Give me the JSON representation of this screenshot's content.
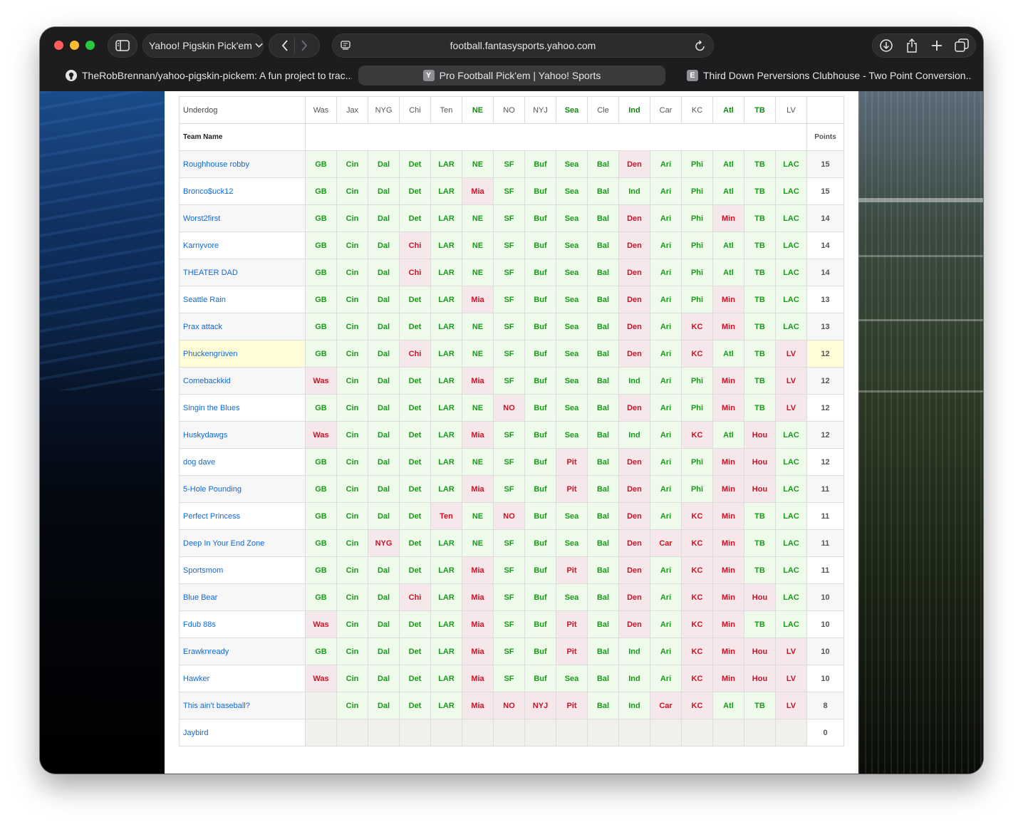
{
  "browser": {
    "tab_group": "Yahoo! Pigskin Pick'em",
    "url": "football.fantasysports.yahoo.com",
    "tabs": [
      {
        "favicon": "github-icon",
        "title": "TheRobBrennan/yahoo-pigskin-pickem: A fun project to trac..."
      },
      {
        "favicon": "Y",
        "title": "Pro Football Pick'em | Yahoo! Sports"
      },
      {
        "favicon": "E",
        "title": "Third Down Perversions Clubhouse - Two Point Conversion..."
      }
    ]
  },
  "table": {
    "underdog_label": "Underdog",
    "team_name_label": "Team Name",
    "points_label": "Points",
    "underdogs": [
      {
        "team": "Was",
        "covered": false
      },
      {
        "team": "Jax",
        "covered": false
      },
      {
        "team": "NYG",
        "covered": false
      },
      {
        "team": "Chi",
        "covered": false
      },
      {
        "team": "Ten",
        "covered": false
      },
      {
        "team": "NE",
        "covered": true
      },
      {
        "team": "NO",
        "covered": false
      },
      {
        "team": "NYJ",
        "covered": false
      },
      {
        "team": "Sea",
        "covered": true
      },
      {
        "team": "Cle",
        "covered": false
      },
      {
        "team": "Ind",
        "covered": true
      },
      {
        "team": "Car",
        "covered": false
      },
      {
        "team": "KC",
        "covered": false
      },
      {
        "team": "Atl",
        "covered": true
      },
      {
        "team": "TB",
        "covered": true
      },
      {
        "team": "LV",
        "covered": false
      }
    ],
    "rows": [
      {
        "name": "Roughhouse robby",
        "points": "15",
        "picks": [
          "GB:w",
          "Cin:w",
          "Dal:w",
          "Det:w",
          "LAR:w",
          "NE:w",
          "SF:w",
          "Buf:w",
          "Sea:w",
          "Bal:w",
          "Den:l",
          "Ari:w",
          "Phi:w",
          "Atl:w",
          "TB:w",
          "LAC:w"
        ]
      },
      {
        "name": "Bronco$uck12",
        "points": "15",
        "picks": [
          "GB:w",
          "Cin:w",
          "Dal:w",
          "Det:w",
          "LAR:w",
          "Mia:l",
          "SF:w",
          "Buf:w",
          "Sea:w",
          "Bal:w",
          "Ind:w",
          "Ari:w",
          "Phi:w",
          "Atl:w",
          "TB:w",
          "LAC:w"
        ]
      },
      {
        "name": "Worst2first",
        "points": "14",
        "picks": [
          "GB:w",
          "Cin:w",
          "Dal:w",
          "Det:w",
          "LAR:w",
          "NE:w",
          "SF:w",
          "Buf:w",
          "Sea:w",
          "Bal:w",
          "Den:l",
          "Ari:w",
          "Phi:w",
          "Min:l",
          "TB:w",
          "LAC:w"
        ]
      },
      {
        "name": "Karnyvore",
        "points": "14",
        "picks": [
          "GB:w",
          "Cin:w",
          "Dal:w",
          "Chi:l",
          "LAR:w",
          "NE:w",
          "SF:w",
          "Buf:w",
          "Sea:w",
          "Bal:w",
          "Den:l",
          "Ari:w",
          "Phi:w",
          "Atl:w",
          "TB:w",
          "LAC:w"
        ]
      },
      {
        "name": "THEATER DAD",
        "points": "14",
        "picks": [
          "GB:w",
          "Cin:w",
          "Dal:w",
          "Chi:l",
          "LAR:w",
          "NE:w",
          "SF:w",
          "Buf:w",
          "Sea:w",
          "Bal:w",
          "Den:l",
          "Ari:w",
          "Phi:w",
          "Atl:w",
          "TB:w",
          "LAC:w"
        ]
      },
      {
        "name": "Seattle Rain",
        "points": "13",
        "picks": [
          "GB:w",
          "Cin:w",
          "Dal:w",
          "Det:w",
          "LAR:w",
          "Mia:l",
          "SF:w",
          "Buf:w",
          "Sea:w",
          "Bal:w",
          "Den:l",
          "Ari:w",
          "Phi:w",
          "Min:l",
          "TB:w",
          "LAC:w"
        ]
      },
      {
        "name": "Prax attack",
        "points": "13",
        "picks": [
          "GB:w",
          "Cin:w",
          "Dal:w",
          "Det:w",
          "LAR:w",
          "NE:w",
          "SF:w",
          "Buf:w",
          "Sea:w",
          "Bal:w",
          "Den:l",
          "Ari:w",
          "KC:l",
          "Min:l",
          "TB:w",
          "LAC:w"
        ]
      },
      {
        "name": "Phuckengrüven",
        "points": "12",
        "me": true,
        "picks": [
          "GB:w",
          "Cin:w",
          "Dal:w",
          "Chi:l",
          "LAR:w",
          "NE:w",
          "SF:w",
          "Buf:w",
          "Sea:w",
          "Bal:w",
          "Den:l",
          "Ari:w",
          "KC:l",
          "Atl:w",
          "TB:w",
          "LV:l"
        ]
      },
      {
        "name": "Comebackkid",
        "points": "12",
        "picks": [
          "Was:l",
          "Cin:w",
          "Dal:w",
          "Det:w",
          "LAR:w",
          "Mia:l",
          "SF:w",
          "Buf:w",
          "Sea:w",
          "Bal:w",
          "Ind:w",
          "Ari:w",
          "Phi:w",
          "Min:l",
          "TB:w",
          "LV:l"
        ]
      },
      {
        "name": "Singin the Blues",
        "points": "12",
        "picks": [
          "GB:w",
          "Cin:w",
          "Dal:w",
          "Det:w",
          "LAR:w",
          "NE:w",
          "NO:l",
          "Buf:w",
          "Sea:w",
          "Bal:w",
          "Den:l",
          "Ari:w",
          "Phi:w",
          "Min:l",
          "TB:w",
          "LV:l"
        ]
      },
      {
        "name": "Huskydawgs",
        "points": "12",
        "picks": [
          "Was:l",
          "Cin:w",
          "Dal:w",
          "Det:w",
          "LAR:w",
          "Mia:l",
          "SF:w",
          "Buf:w",
          "Sea:w",
          "Bal:w",
          "Ind:w",
          "Ari:w",
          "KC:l",
          "Atl:w",
          "Hou:l",
          "LAC:w"
        ]
      },
      {
        "name": "dog dave",
        "points": "12",
        "picks": [
          "GB:w",
          "Cin:w",
          "Dal:w",
          "Det:w",
          "LAR:w",
          "NE:w",
          "SF:w",
          "Buf:w",
          "Pit:l",
          "Bal:w",
          "Den:l",
          "Ari:w",
          "Phi:w",
          "Min:l",
          "Hou:l",
          "LAC:w"
        ]
      },
      {
        "name": "5-Hole Pounding",
        "points": "11",
        "picks": [
          "GB:w",
          "Cin:w",
          "Dal:w",
          "Det:w",
          "LAR:w",
          "Mia:l",
          "SF:w",
          "Buf:w",
          "Pit:l",
          "Bal:w",
          "Den:l",
          "Ari:w",
          "Phi:w",
          "Min:l",
          "Hou:l",
          "LAC:w"
        ]
      },
      {
        "name": "Perfect Princess",
        "points": "11",
        "picks": [
          "GB:w",
          "Cin:w",
          "Dal:w",
          "Det:w",
          "Ten:l",
          "NE:w",
          "NO:l",
          "Buf:w",
          "Sea:w",
          "Bal:w",
          "Den:l",
          "Ari:w",
          "KC:l",
          "Min:l",
          "TB:w",
          "LAC:w"
        ]
      },
      {
        "name": "Deep In Your End Zone",
        "points": "11",
        "picks": [
          "GB:w",
          "Cin:w",
          "NYG:l",
          "Det:w",
          "LAR:w",
          "NE:w",
          "SF:w",
          "Buf:w",
          "Sea:w",
          "Bal:w",
          "Den:l",
          "Car:l",
          "KC:l",
          "Min:l",
          "TB:w",
          "LAC:w"
        ]
      },
      {
        "name": "Sportsmom",
        "points": "11",
        "picks": [
          "GB:w",
          "Cin:w",
          "Dal:w",
          "Det:w",
          "LAR:w",
          "Mia:l",
          "SF:w",
          "Buf:w",
          "Pit:l",
          "Bal:w",
          "Den:l",
          "Ari:w",
          "KC:l",
          "Min:l",
          "TB:w",
          "LAC:w"
        ]
      },
      {
        "name": "Blue Bear",
        "points": "10",
        "picks": [
          "GB:w",
          "Cin:w",
          "Dal:w",
          "Chi:l",
          "LAR:w",
          "Mia:l",
          "SF:w",
          "Buf:w",
          "Sea:w",
          "Bal:w",
          "Den:l",
          "Ari:w",
          "KC:l",
          "Min:l",
          "Hou:l",
          "LAC:w"
        ]
      },
      {
        "name": "Fdub 88s",
        "points": "10",
        "picks": [
          "Was:l",
          "Cin:w",
          "Dal:w",
          "Det:w",
          "LAR:w",
          "Mia:l",
          "SF:w",
          "Buf:w",
          "Pit:l",
          "Bal:w",
          "Den:l",
          "Ari:w",
          "KC:l",
          "Min:l",
          "TB:w",
          "LAC:w"
        ]
      },
      {
        "name": "Erawknready",
        "points": "10",
        "picks": [
          "GB:w",
          "Cin:w",
          "Dal:w",
          "Det:w",
          "LAR:w",
          "Mia:l",
          "SF:w",
          "Buf:w",
          "Pit:l",
          "Bal:w",
          "Ind:w",
          "Ari:w",
          "KC:l",
          "Min:l",
          "Hou:l",
          "LV:l"
        ]
      },
      {
        "name": "Hawker",
        "points": "10",
        "picks": [
          "Was:l",
          "Cin:w",
          "Dal:w",
          "Det:w",
          "LAR:w",
          "Mia:l",
          "SF:w",
          "Buf:w",
          "Sea:w",
          "Bal:w",
          "Ind:w",
          "Ari:w",
          "KC:l",
          "Min:l",
          "Hou:l",
          "LV:l"
        ]
      },
      {
        "name": "This ain't baseball?",
        "points": "8",
        "picks": [
          ":e",
          "Cin:w",
          "Dal:w",
          "Det:w",
          "LAR:w",
          "Mia:l",
          "NO:l",
          "NYJ:l",
          "Pit:l",
          "Bal:w",
          "Ind:w",
          "Car:l",
          "KC:l",
          "Atl:w",
          "TB:w",
          "LV:l"
        ]
      },
      {
        "name": "Jaybird",
        "points": "0",
        "picks": [
          ":e",
          ":e",
          ":e",
          ":e",
          ":e",
          ":e",
          ":e",
          ":e",
          ":e",
          ":e",
          ":e",
          ":e",
          ":e",
          ":e",
          ":e",
          ":e"
        ]
      }
    ]
  },
  "colors": {
    "win": "#1a9a1a",
    "loss": "#cc1128",
    "link": "#0f69d8",
    "highlight": "#fefdd8"
  }
}
